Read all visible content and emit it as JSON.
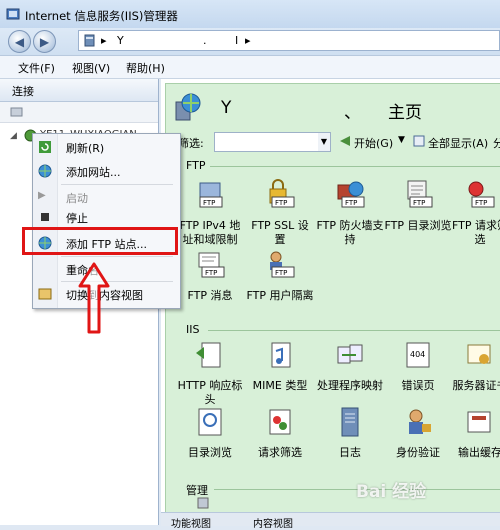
{
  "window": {
    "title": "Internet 信息服务(IIS)管理器"
  },
  "address": {
    "seg1": "Y",
    "seg2": ".",
    "seg3": "I",
    "arrow1": "▸",
    "arrow2": "▸"
  },
  "menu": {
    "file": "文件(F)",
    "view": "视图(V)",
    "help": "帮助(H)"
  },
  "left": {
    "header": "连接",
    "tree_node": "YE11_WUXIAOGIAN"
  },
  "context_menu": {
    "items": [
      {
        "label": "刷新(R)",
        "icon": "refresh-icon"
      },
      {
        "label": "添加网站...",
        "icon": "globe-add-icon"
      },
      {
        "label": "启动",
        "icon": "play-icon",
        "disabled": true
      },
      {
        "label": "停止",
        "icon": "stop-icon"
      },
      {
        "label": "添加 FTP 站点...",
        "icon": "ftp-add-icon"
      },
      {
        "label": "重命名",
        "icon": ""
      },
      {
        "label": "切换到内容视图",
        "icon": "content-view-icon"
      }
    ]
  },
  "main": {
    "server_name": "Y",
    "dash": "、",
    "home": "主页",
    "filter_label": "筛选:",
    "start_btn": "开始(G)",
    "show_all_btn": "全部显示(A)",
    "group_btn": "分组"
  },
  "groups": {
    "ftp": {
      "label": "FTP",
      "items": [
        "FTP IPv4 地址和域限制",
        "FTP SSL 设置",
        "FTP 防火墙支持",
        "FTP 目录浏览",
        "FTP 请求筛选",
        "FTP 消息",
        "FTP 用户隔离"
      ]
    },
    "iis": {
      "label": "IIS",
      "items": [
        "HTTP 响应标头",
        "MIME 类型",
        "处理程序映射",
        "错误页",
        "服务器证书",
        "目录浏览",
        "请求筛选",
        "日志",
        "身份验证",
        "输出缓存"
      ]
    },
    "manage": {
      "label": "管理"
    }
  },
  "bottom": {
    "features_tab": "功能视图",
    "content_tab": "内容视图"
  },
  "watermark": "Bai 经验",
  "colors": {
    "highlight": "#e01515",
    "content_bg": "#d8f0d8"
  }
}
